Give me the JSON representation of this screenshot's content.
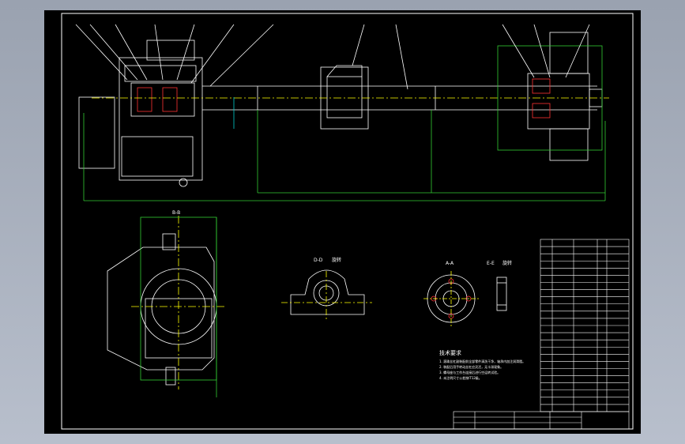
{
  "drawing": {
    "section_bb": "B-B",
    "section_dd": "D-D",
    "rotate_word": "旋转",
    "section_aa": "A-A",
    "section_ee": "E-E",
    "tech_title": "技术要求",
    "tech_notes": [
      "1. 滚珠丝杠副装配前全部零件清洗干净，轴承内加注润滑脂。",
      "2. 装配后用手转动丝杠应灵活，无卡滞现象。",
      "3. 螺母座与工作台连接后进行空运转试验。",
      "4. 未注明尺寸公差按IT12级。"
    ],
    "bom_rows": 24,
    "colors": {
      "outline": "#ffffff",
      "dim_green": "#33cc33",
      "center_yellow": "#ffff00",
      "accent_cyan": "#00cccc",
      "accent_red": "#ff3333",
      "canvas": "#000000"
    }
  }
}
